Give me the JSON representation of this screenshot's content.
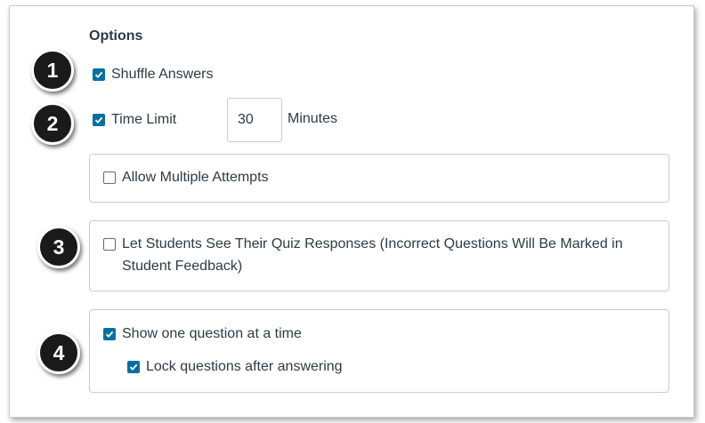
{
  "options": {
    "title": "Options",
    "shuffle_answers": {
      "label": "Shuffle Answers",
      "checked": true
    },
    "time_limit": {
      "label": "Time Limit",
      "checked": true,
      "value": "30",
      "unit": "Minutes"
    },
    "multiple_attempts": {
      "label": "Allow Multiple Attempts",
      "checked": false
    },
    "see_responses": {
      "label": "Let Students See Their Quiz Responses (Incorrect Questions Will Be Marked in Student Feedback)",
      "checked": false
    },
    "one_question": {
      "label": "Show one question at a time",
      "checked": true
    },
    "lock_questions": {
      "label": "Lock questions after answering",
      "checked": true
    }
  },
  "badges": [
    "1",
    "2",
    "3",
    "4"
  ],
  "colors": {
    "checkbox": "#0770a3",
    "text": "#2d3b45",
    "border": "#c7cdd1",
    "badge": "#1a1a1a"
  }
}
